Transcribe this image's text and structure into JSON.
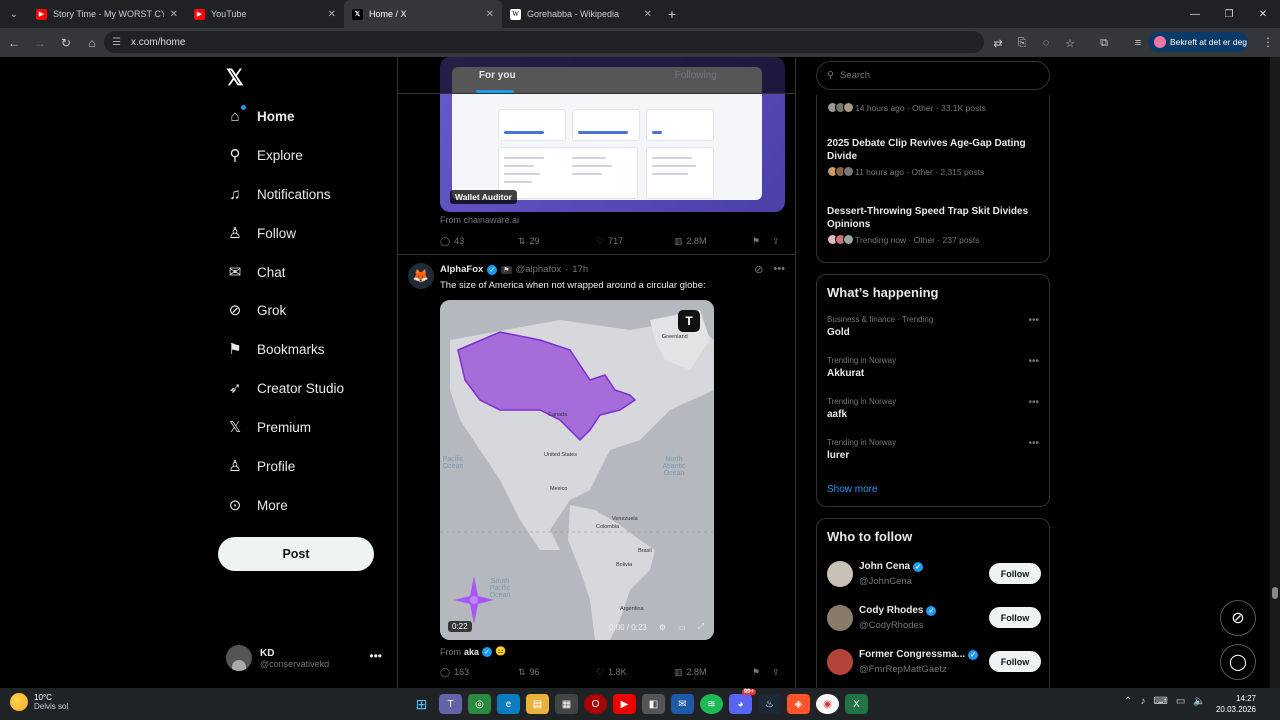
{
  "browser": {
    "tabs": [
      {
        "title": "Story Time - My WORST CYCLE",
        "favicon": "youtube-red",
        "active": false
      },
      {
        "title": "YouTube",
        "favicon": "youtube-red",
        "active": false
      },
      {
        "title": "Home / X",
        "favicon": "x-logo",
        "active": true
      },
      {
        "title": "Gorehabba - Wikipedia",
        "favicon": "wikipedia-w",
        "active": false
      }
    ],
    "url": "x.com/home",
    "profile_label": "Bekreft at det er deg"
  },
  "sidebar": {
    "items": [
      {
        "label": "Home",
        "icon": "home-icon",
        "active": true
      },
      {
        "label": "Explore",
        "icon": "search-icon"
      },
      {
        "label": "Notifications",
        "icon": "bell-icon"
      },
      {
        "label": "Follow",
        "icon": "person-plus-icon"
      },
      {
        "label": "Chat",
        "icon": "mail-icon"
      },
      {
        "label": "Grok",
        "icon": "grok-icon"
      },
      {
        "label": "Bookmarks",
        "icon": "bookmark-icon"
      },
      {
        "label": "Creator Studio",
        "icon": "rocket-icon"
      },
      {
        "label": "Premium",
        "icon": "x-icon"
      },
      {
        "label": "Profile",
        "icon": "person-icon"
      },
      {
        "label": "More",
        "icon": "more-circle-icon"
      }
    ],
    "post_label": "Post",
    "account": {
      "name": "KD",
      "handle": "@conservativekd"
    }
  },
  "feed": {
    "tabs": [
      "For you",
      "Following"
    ],
    "card_label": "Wallet Auditor",
    "card_source": "From chainaware.ai",
    "post1_stats": {
      "replies": "43",
      "reposts": "29",
      "likes": "717",
      "views": "2.8M"
    },
    "post2": {
      "name": "AlphaFox",
      "handle": "@alphafox",
      "time": "17h",
      "text": "The size of America when not wrapped around a circular globe:",
      "video_time": "0:22",
      "video_progress": "0:00 / 0:23",
      "from_prefix": "From",
      "from_name": "aka",
      "stats": {
        "replies": "163",
        "reposts": "96",
        "likes": "1.8K",
        "views": "2.8M"
      },
      "map_labels": [
        "Greenland",
        "Canada",
        "United States",
        "Mexico",
        "Venezuela",
        "Colombia",
        "Brasil",
        "Bolivia",
        "Argentina"
      ],
      "ocean_labels": [
        "North Atlantic Ocean",
        "South Pacific Ocean",
        "Pacific Ocean"
      ]
    }
  },
  "right": {
    "search_placeholder": "Search",
    "trends_top": [
      {
        "meta": "14 hours ago · Other · 33.1K posts"
      },
      {
        "title": "2025 Debate Clip Revives Age-Gap Dating Divide",
        "meta": "11 hours ago · Other · 2,315 posts"
      },
      {
        "title": "Dessert-Throwing Speed Trap Skit Divides Opinions",
        "meta": "Trending now · Other · 237 posts"
      }
    ],
    "whats_happening_title": "What’s happening",
    "happening": [
      {
        "context": "Business & finance · Trending",
        "topic": "Gold"
      },
      {
        "context": "Trending in Norway",
        "topic": "Akkurat"
      },
      {
        "context": "Trending in Norway",
        "topic": "aafk"
      },
      {
        "context": "Trending in Norway",
        "topic": "lurer"
      }
    ],
    "show_more": "Show more",
    "who_to_follow_title": "Who to follow",
    "follow": [
      {
        "name": "John Cena",
        "handle": "@JohnCena"
      },
      {
        "name": "Cody Rhodes",
        "handle": "@CodyRhodes"
      },
      {
        "name": "Former Congressma...",
        "handle": "@FmrRepMattGaetz"
      }
    ],
    "follow_label": "Follow"
  },
  "taskbar": {
    "temp": "10°C",
    "weather": "Delvis sol",
    "time": "14:27",
    "date": "20.03.2026",
    "badge": "99+"
  }
}
